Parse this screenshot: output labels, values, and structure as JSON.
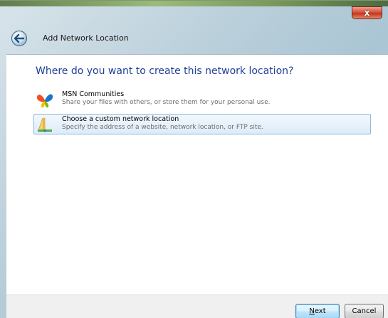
{
  "window": {
    "title": "Add Network Location",
    "close_label": "x"
  },
  "page": {
    "heading": "Where do you want to create this network location?"
  },
  "options": [
    {
      "title": "MSN Communities",
      "description": "Share your files with others, or store them for your personal use.",
      "icon": "msn-butterfly-icon",
      "selected": false
    },
    {
      "title": "Choose a custom network location",
      "description": "Specify the address of a website, network location, or FTP site.",
      "icon": "network-folder-icon",
      "selected": true
    }
  ],
  "footer": {
    "next_label_mnemonic": "N",
    "next_label_rest": "ext",
    "cancel_label": "Cancel"
  },
  "colors": {
    "heading": "#1f3f96",
    "selected_border": "#8fb8dc",
    "close_button": "#c2351d"
  }
}
